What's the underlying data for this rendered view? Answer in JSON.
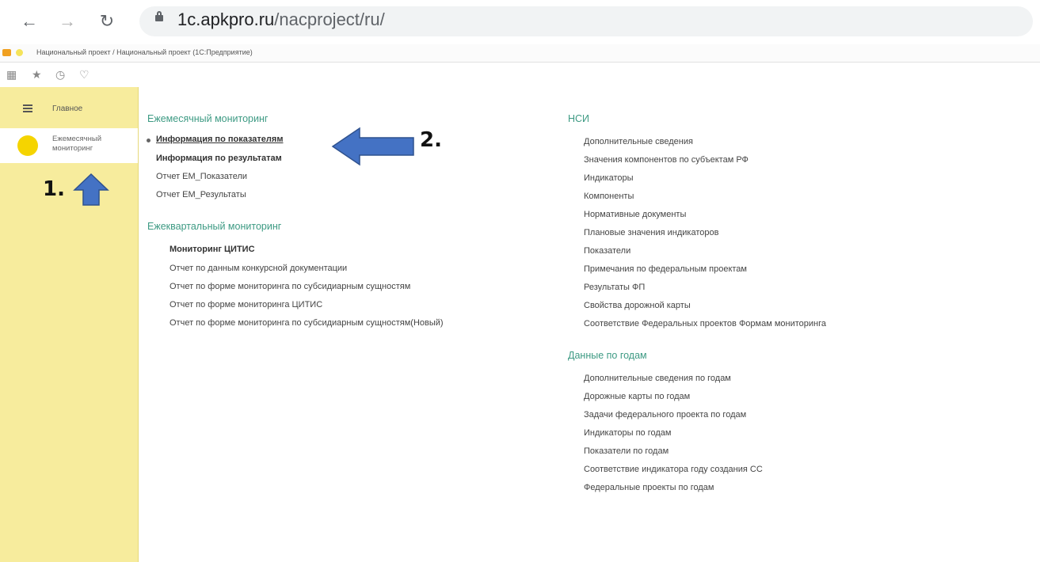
{
  "browser": {
    "url_host": "1c.apkpro.ru",
    "url_path": "/nacproject/ru/"
  },
  "app": {
    "title": "Национальный проект / Национальный проект (1С:Предприятие)"
  },
  "sidebar": {
    "items": [
      {
        "label": "Главное"
      },
      {
        "label": "Ежемесячный мониторинг"
      }
    ]
  },
  "annotations": {
    "step1": "1.",
    "step2": "2."
  },
  "content": {
    "left": {
      "sections": [
        {
          "title": "Ежемесячный мониторинг",
          "items": [
            "Информация по показателям",
            "Информация по результатам",
            "Отчет ЕМ_Показатели",
            "Отчет ЕМ_Результаты"
          ]
        },
        {
          "title": "Ежеквартальный мониторинг",
          "items": [
            "Мониторинг ЦИТИС",
            "Отчет по данным конкурсной документации",
            "Отчет по форме мониторинга по субсидиарным сущностям",
            "Отчет по форме мониторинга ЦИТИС",
            "Отчет по форме мониторинга по субсидиарным сущностям(Новый)"
          ]
        }
      ]
    },
    "right": {
      "sections": [
        {
          "title": "НСИ",
          "items": [
            "Дополнительные сведения",
            "Значения компонентов по субъектам РФ",
            "Индикаторы",
            "Компоненты",
            "Нормативные документы",
            "Плановые значения индикаторов",
            "Показатели",
            "Примечания по федеральным проектам",
            "Результаты ФП",
            "Свойства дорожной карты",
            "Соответствие Федеральных проектов Формам мониторинга"
          ]
        },
        {
          "title": "Данные по годам",
          "items": [
            "Дополнительные сведения по годам",
            "Дорожные карты по годам",
            "Задачи федерального проекта по годам",
            "Индикаторы по годам",
            "Показатели по годам",
            "Соответствие индикатора году создания СС",
            "Федеральные проекты по годам"
          ]
        }
      ]
    }
  }
}
